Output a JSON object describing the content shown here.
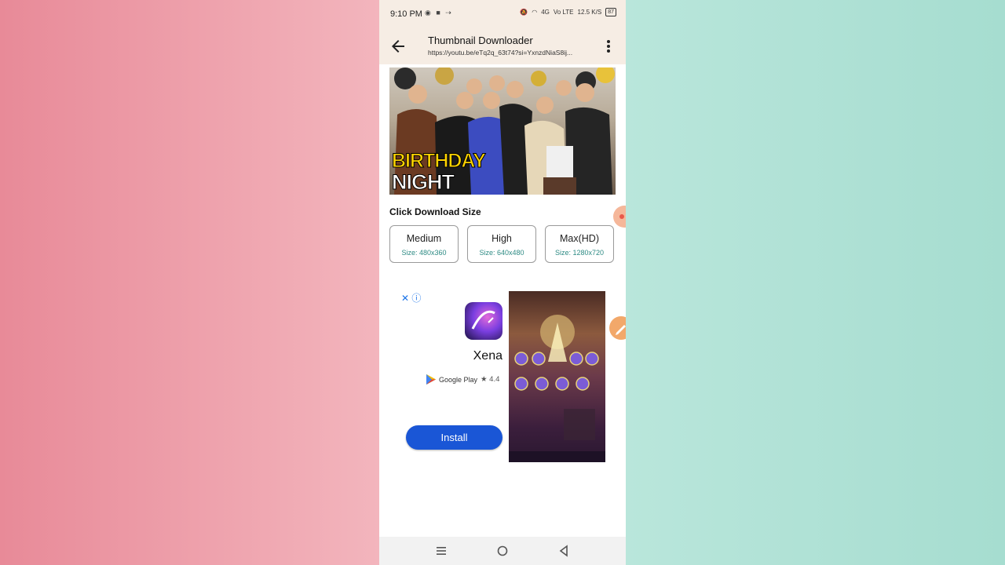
{
  "status": {
    "time": "9:10 PM",
    "network": "4G",
    "lte": "Vo LTE",
    "speed": "12.5 K/S",
    "battery": "87"
  },
  "appbar": {
    "title": "Thumbnail Downloader",
    "url": "https://youtu.be/eTq2q_63t74?si=YxnzdNiaS8ij..."
  },
  "thumbnail": {
    "line1": "BIRTHDAY",
    "line2": "NIGHT"
  },
  "sizes": {
    "heading": "Click Download Size",
    "options": [
      {
        "label": "Medium",
        "size": "Size: 480x360"
      },
      {
        "label": "High",
        "size": "Size: 640x480"
      },
      {
        "label": "Max(HD)",
        "size": "Size: 1280x720"
      }
    ]
  },
  "ad": {
    "app_name": "Xena",
    "store": "Google Play",
    "rating": "★ 4.4",
    "install_label": "Install"
  },
  "colors": {
    "accent": "#1a56d6",
    "size_text": "#2e8b84",
    "appbar_bg": "#f6ede4"
  },
  "icons": [
    "arrow-back-icon",
    "more-vert-icon",
    "ad-close-icon",
    "ad-info-icon",
    "google-play-icon",
    "nav-menu-icon",
    "nav-home-icon",
    "nav-back-icon"
  ]
}
